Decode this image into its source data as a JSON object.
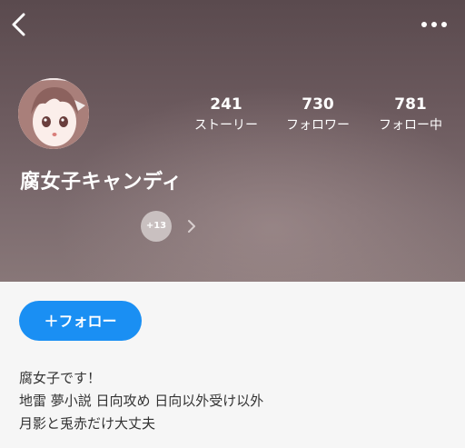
{
  "profile": {
    "name": "腐女子キャンディ",
    "stats": {
      "stories": {
        "value": "241",
        "label": "ストーリー"
      },
      "followers": {
        "value": "730",
        "label": "フォロワー"
      },
      "following": {
        "value": "781",
        "label": "フォロー中"
      }
    },
    "badges_more": "+13"
  },
  "actions": {
    "follow_label": "＋フォロー"
  },
  "bio": {
    "lines": [
      "腐女子です！",
      "地雷 夢小説 日向攻め 日向以外受け以外",
      "月影と兎赤だけ大丈夫"
    ]
  },
  "icons": {
    "back": "chevron-left-icon",
    "more": "more-horizontal-icon",
    "badge_next": "chevron-right-icon"
  },
  "colors": {
    "accent": "#1a8ff3",
    "background": "#f6f6f6"
  }
}
